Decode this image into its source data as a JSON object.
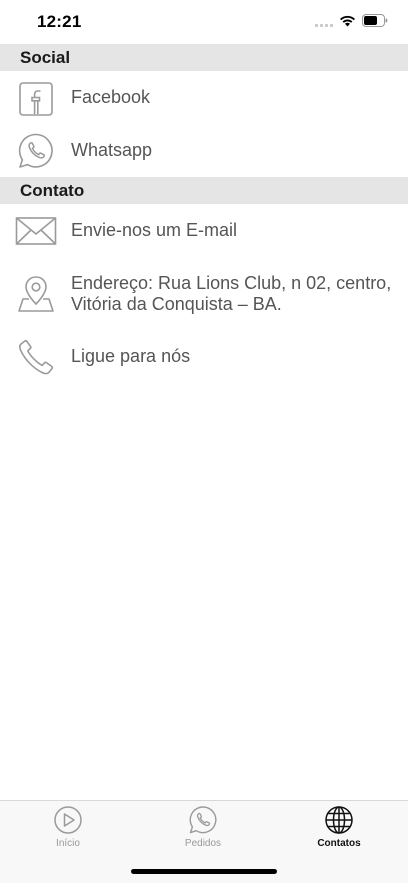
{
  "status_bar": {
    "time": "12:21"
  },
  "sections": {
    "social": {
      "title": "Social"
    },
    "contato": {
      "title": "Contato"
    }
  },
  "items": {
    "facebook": {
      "label": "Facebook",
      "icon": "facebook-icon"
    },
    "whatsapp": {
      "label": "Whatsapp",
      "icon": "whatsapp-icon"
    },
    "email": {
      "label": "Envie-nos um E-mail",
      "icon": "mail-icon"
    },
    "address": {
      "label": "Endereço: Rua Lions Club, n 02, centro, Vitória da Conquista – BA.",
      "icon": "location-pin-icon"
    },
    "phone": {
      "label": "Ligue para nós",
      "icon": "phone-icon"
    }
  },
  "tab_bar": {
    "tabs": [
      {
        "label": "Início",
        "icon": "play-circle-icon",
        "active": false
      },
      {
        "label": "Pedidos",
        "icon": "whatsapp-icon",
        "active": false
      },
      {
        "label": "Contatos",
        "icon": "globe-icon",
        "active": true
      }
    ]
  },
  "colors": {
    "section_bg": "#e5e5e5",
    "icon_gray": "#9a9a9a",
    "active_tab": "#111111",
    "inactive_tab": "#999999"
  }
}
